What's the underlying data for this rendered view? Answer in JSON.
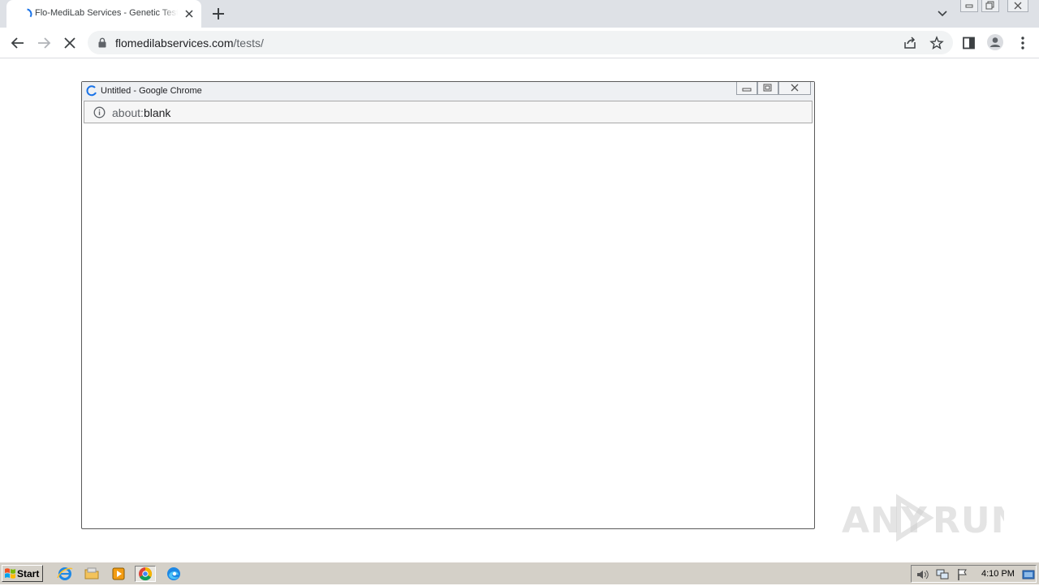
{
  "browser": {
    "tab": {
      "title": "Flo-MediLab Services - Genetic Tests"
    },
    "address_bar": {
      "host": "flomedilabservices.com",
      "path": "/tests/"
    }
  },
  "popup": {
    "window_title": "Untitled - Google Chrome",
    "url_scheme": "about:",
    "url_rest": "blank"
  },
  "watermark": {
    "text": "ANY RUN"
  },
  "taskbar": {
    "start_label": "Start",
    "clock": "4:10 PM",
    "apps": [
      "internet-explorer-icon",
      "file-explorer-icon",
      "media-player-icon",
      "chrome-icon",
      "edge-icon"
    ]
  },
  "colors": {
    "accent_blue": "#1a73e8",
    "taskbar": "#d4d0c8",
    "tabstrip": "#dee1e6"
  }
}
